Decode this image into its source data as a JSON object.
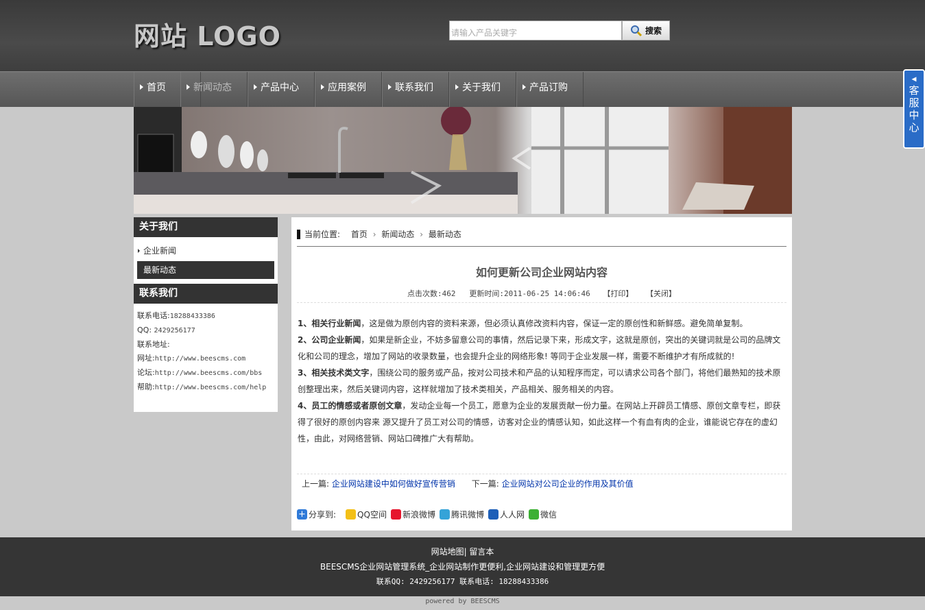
{
  "header": {
    "logo": "网站 LOGO",
    "search_placeholder": "请输入产品关键字",
    "search_button": "搜索"
  },
  "nav": {
    "items": [
      "首页",
      "新闻动态",
      "产品中心",
      "应用案例",
      "联系我们",
      "关于我们",
      "产品订购"
    ],
    "active": "新闻动态"
  },
  "service_tab": "客服中心",
  "sidebar": {
    "about_title": "关于我们",
    "categories": [
      "企业新闻",
      "最新动态"
    ],
    "contact_title": "联系我们",
    "contact": {
      "phone_label": "联系电话:",
      "phone": "18288433386",
      "qq_label": "QQ:",
      "qq": "2429256177",
      "address_label": "联系地址:",
      "web_label": "网址:",
      "web": "http://www.beescms.com",
      "forum_label": "论坛:",
      "forum": "http://www.beescms.com/bbs",
      "help_label": "帮助:",
      "help": "http://www.beescms.com/help"
    }
  },
  "breadcrumb": {
    "label": "当前位置:",
    "items": [
      "首页",
      "新闻动态",
      "最新动态"
    ]
  },
  "article": {
    "title": "如何更新公司企业网站内容",
    "meta": "点击次数:462   更新时间:2011-06-25 14:06:46",
    "print": "【打印】",
    "close": "【关闭】",
    "paragraphs": [
      {
        "lead": "1、相关行业新闻",
        "text": "，这是做为原创内容的资料来源，但必须认真修改资料内容，保证一定的原创性和新鲜感。避免简单复制。"
      },
      {
        "lead": "2、公司企业新闻",
        "text": "，如果是新企业，不妨多留意公司的事情，然后记录下来，形成文字，这就是原创，突出的关键词就是公司的品牌文化和公司的理念，增加了网站的收录数量，也会提升企业的网络形象! 等同于企业发展一样，需要不断维护才有所成就的!"
      },
      {
        "lead": "3、相关技术类文字",
        "text": "，围绕公司的服务或产品，按对公司技术和产品的认知程序而定，可以请求公司各个部门，将他们最熟知的技术原创整理出来，然后关键词内容，这样就增加了技术类相关，产品相关、服务相关的内容。"
      },
      {
        "lead": "4、员工的情感或者原创文章",
        "text": "，发动企业每一个员工，愿意为企业的发展贡献一份力量。在网站上开辟员工情感、原创文章专栏，即获得了很好的原创内容来 源又提升了员工对公司的情感，访客对企业的情感认知，如此这样一个有血有肉的企业，谁能说它存在的虚幻性，由此，对网络营销、网站口碑推广大有帮助。"
      }
    ],
    "prev_label": "上一篇:",
    "prev_link": "企业网站建设中如何做好宣传营销",
    "next_label": "下一篇:",
    "next_link": "企业网站对公司企业的作用及其价值"
  },
  "share": {
    "label": "分享到:",
    "items": [
      "QQ空间",
      "新浪微博",
      "腾讯微博",
      "人人网",
      "微信"
    ]
  },
  "footer": {
    "links": "网站地图| 留言本",
    "line1": "BEESCMS企业网站管理系统_企业网站制作更便利,企业网站建设和管理更方便",
    "line2": "联系QQ: 2429256177 联系电话: 18288433386",
    "powered": "powered by BEESCMS"
  }
}
